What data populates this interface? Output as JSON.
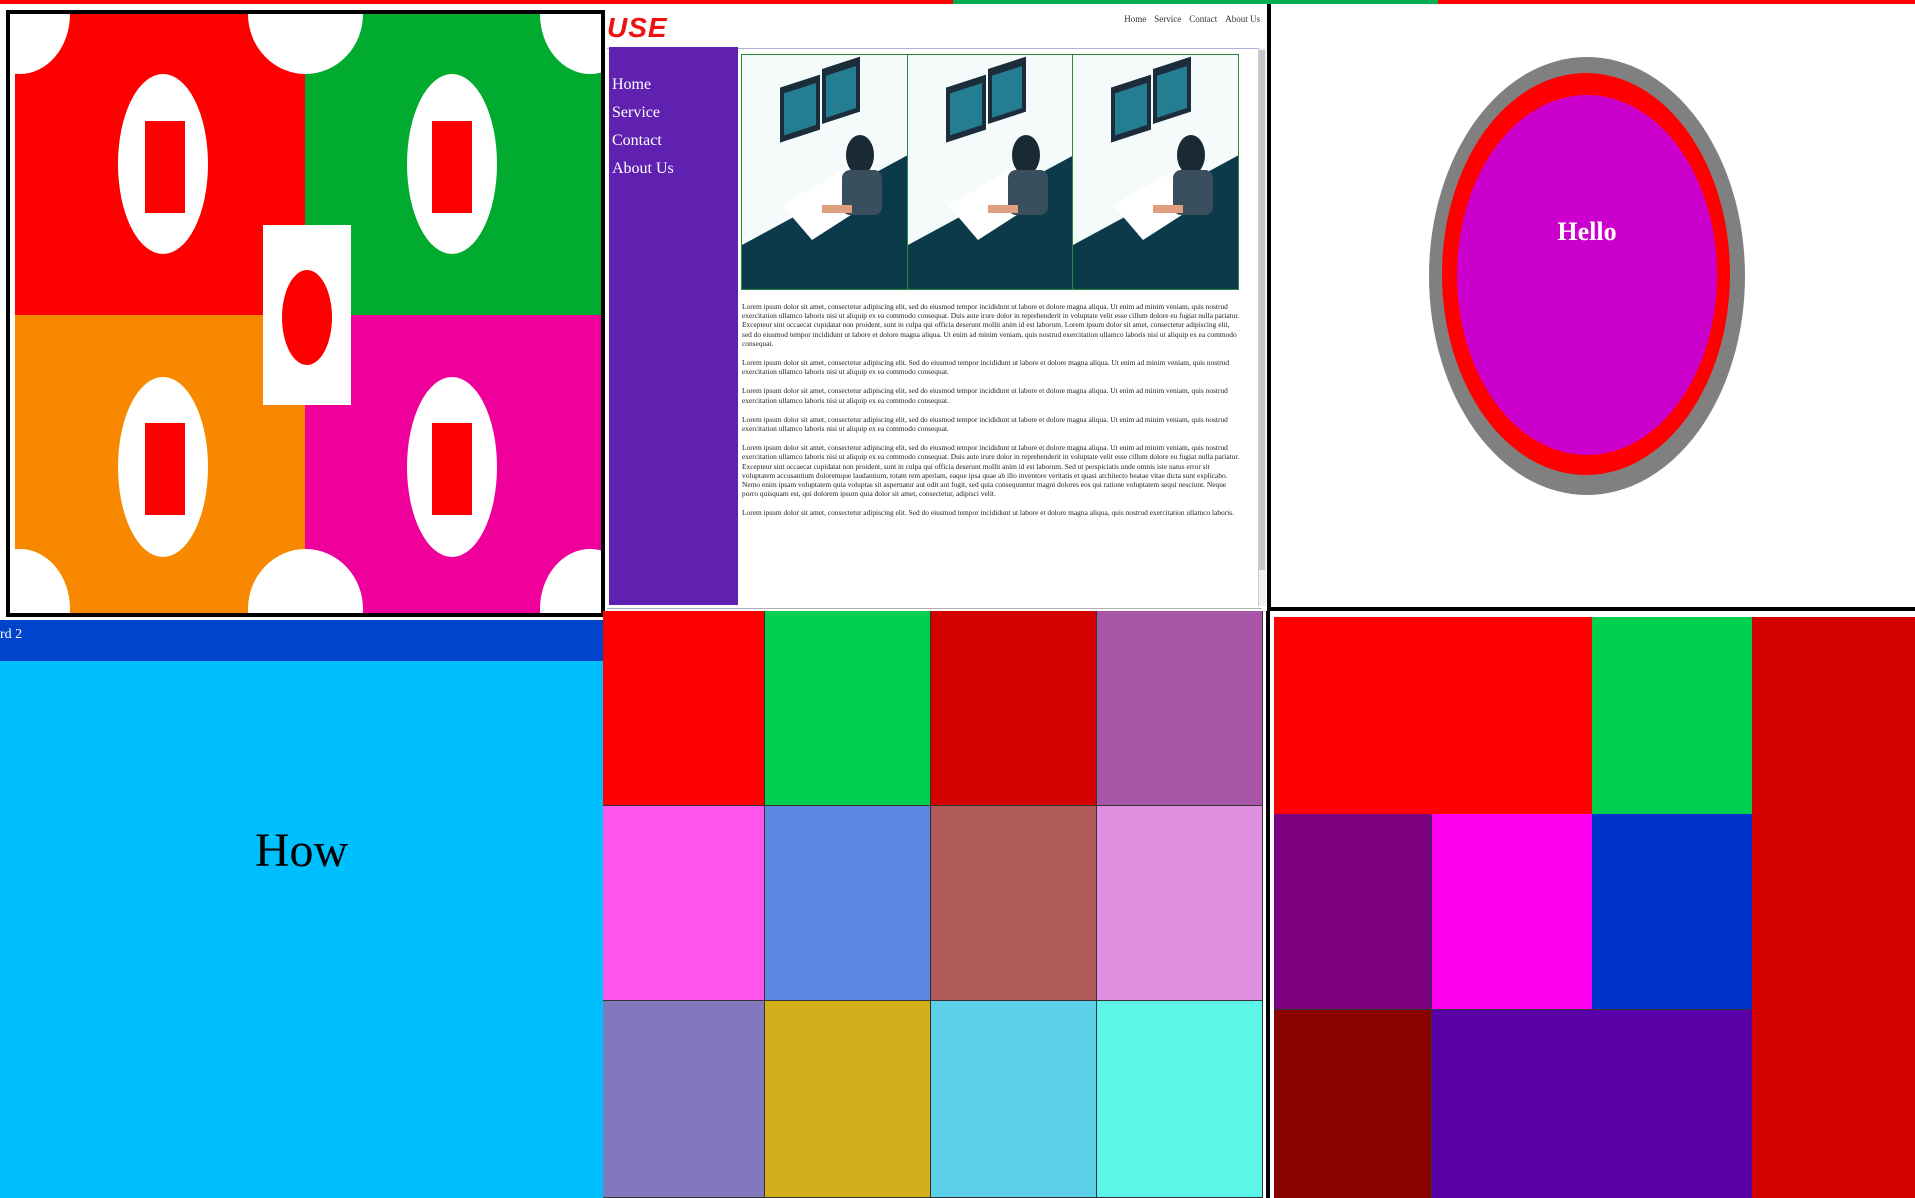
{
  "colors": {
    "stripe": [
      "#ff0000",
      "#ff0000",
      "#00b050",
      "#ff0000"
    ],
    "panel1": {
      "red": "#ff0000",
      "green": "#00ab30",
      "orange": "#f78800",
      "pink": "#ef009a"
    },
    "panel4_bar": "#0044cc",
    "panel4_bg": "#00bfff"
  },
  "website": {
    "logo": "USE",
    "top_nav": [
      "Home",
      "Service",
      "Contact",
      "About Us"
    ],
    "sidebar": [
      "Home",
      "Service",
      "Contact",
      "About Us"
    ],
    "gallery": [
      {
        "icon": "desk-workstation-illustration"
      },
      {
        "icon": "desk-workstation-illustration"
      },
      {
        "icon": "desk-workstation-illustration"
      }
    ],
    "paragraphs": [
      "Lorem ipsum dolor sit amet, consectetur adipiscing elit, sed do eiusmod tempor incididunt ut labore et dolore magna aliqua. Ut enim ad minim veniam, quis nostrud exercitation ullamco laboris nisi ut aliquip ex ea commodo consequat. Duis aute irure dolor in reprehenderit in voluptate velit esse cillum dolore eu fugiat nulla pariatur. Excepteur sint occaecat cupidatat non proident, sunt in culpa qui officia deserunt mollit anim id est laborum. Lorem ipsum dolor sit amet, consectetur adipiscing elit, sed do eiusmod tempor incididunt ut labore et dolore magna aliqua. Ut enim ad minim veniam, quis nostrud exercitation ullamco laboris nisi ut aliquip ex ea commodo consequat.",
      "Lorem ipsum dolor sit amet, consectetur adipiscing elit. Sed do eiusmod tempor incididunt ut labore et dolore magna aliqua. Ut enim ad minim veniam, quis nostrud exercitation ullamco laboris nisi ut aliquip ex ea commodo consequat.",
      "Lorem ipsum dolor sit amet, consectetur adipiscing elit, sed do eiusmod tempor incididunt ut labore et dolore magna aliqua. Ut enim ad minim veniam, quis nostrud exercitation ullamco laboris nisi ut aliquip ex ea commodo consequat.",
      "Lorem ipsum dolor sit amet, consectetur adipiscing elit, sed do eiusmod tempor incididunt ut labore et dolore magna aliqua. Ut enim ad minim veniam, quis nostrud exercitation ullamco laboris nisi ut aliquip ex ea commodo consequat.",
      "Lorem ipsum dolor sit amet, consectetur adipiscing elit, sed do eiusmod tempor incididunt ut labore et dolore magna aliqua. Ut enim ad minim veniam, quis nostrud exercitation ullamco laboris nisi ut aliquip ex ea commodo consequat. Duis aute irure dolor in reprehenderit in voluptate velit esse cillum dolore eu fugiat nulla pariatur. Excepteur sint occaecat cupidatat non proident, sunt in culpa qui officia deserunt mollit anim id est laborum. Sed ut perspiciatis unde omnis iste natus error sit voluptatem accusantium doloremque laudantium, totam rem aperiam, eaque ipsa quae ab illo inventore veritatis et quasi architecto beatae vitae dicta sunt explicabo. Nemo enim ipsam voluptatem quia voluptas sit aspernatur aut odit aut fugit, sed quia consequuntur magni dolores eos qui ratione voluptatem sequi nesciunt. Neque porro quisquam est, qui dolorem ipsum quia dolor sit amet, consectetur, adipisci velit.",
      "Lorem ipsum dolor sit amet, consectetur adipiscing elit. Sed do eiusmod tempor incididunt ut labore et dolore magna aliqua, quis nostrud exercitation ullamco laboris."
    ]
  },
  "hello": {
    "text": "Hello",
    "colors": {
      "outer": "#808080",
      "ring": "#ff0000",
      "fill": "#cc00cc"
    }
  },
  "card": {
    "title": "rd 2",
    "text": "How"
  },
  "grid_colors": [
    "#ff0000",
    "#00d050",
    "#d50000",
    "#a855a8",
    "#ff55ee",
    "#5b88e0",
    "#b05a5a",
    "#df8fe0",
    "#8278bd",
    "#d4af1c",
    "#5bd0e8",
    "#5cf5e8"
  ],
  "layout_colors": {
    "red_top": "#ff0000",
    "green_top": "#00d050",
    "right_tall": "#d50000",
    "purple": "#7d0080",
    "magenta": "#ff00ee",
    "blue": "#0033cc",
    "maroon": "#8b0000",
    "indigo": "#5a00a8"
  }
}
